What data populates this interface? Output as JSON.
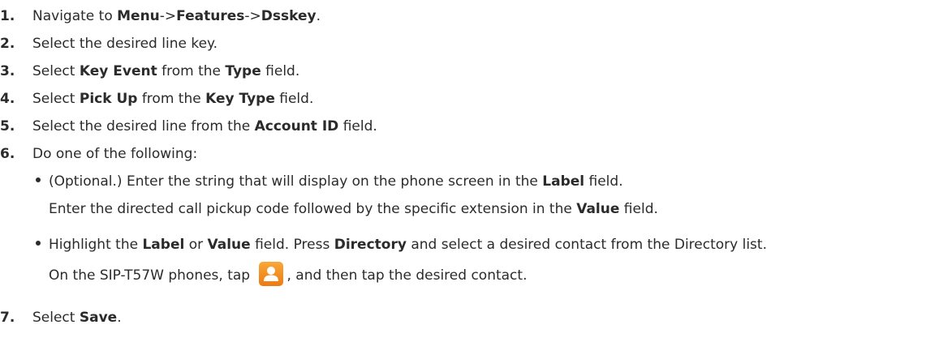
{
  "steps": [
    {
      "num": "1.",
      "parts": [
        "Navigate to ",
        "Menu",
        "->",
        "Features",
        "->",
        "Dsskey",
        "."
      ]
    },
    {
      "num": "2.",
      "text": "Select the desired line key."
    },
    {
      "num": "3.",
      "parts": [
        "Select ",
        "Key Event",
        " from the ",
        "Type",
        " field."
      ]
    },
    {
      "num": "4.",
      "parts": [
        "Select ",
        "Pick Up",
        " from the ",
        "Key Type",
        " field."
      ]
    },
    {
      "num": "5.",
      "parts": [
        "Select the desired line from the ",
        "Account ID",
        " field."
      ]
    },
    {
      "num": "6.",
      "text": "Do one of the following:"
    },
    {
      "num": "7.",
      "parts": [
        "Select ",
        "Save",
        "."
      ]
    }
  ],
  "bullets": [
    {
      "parts": [
        "(Optional.) Enter the string that will display on the phone screen in the ",
        "Label",
        " field."
      ],
      "continuation": [
        "Enter the directed call pickup code followed by the specific extension in the ",
        "Value",
        " field."
      ]
    },
    {
      "parts": [
        "Highlight the ",
        "Label",
        " or ",
        "Value",
        " field. Press ",
        "Directory",
        " and select a desired contact from the Directory list."
      ],
      "continuation": [
        "On the SIP-T57W phones, tap ",
        ", and then tap the desired contact."
      ]
    }
  ],
  "icons": {
    "contact_icon": "contact-icon",
    "contact_icon_color": "#f28a1c"
  }
}
